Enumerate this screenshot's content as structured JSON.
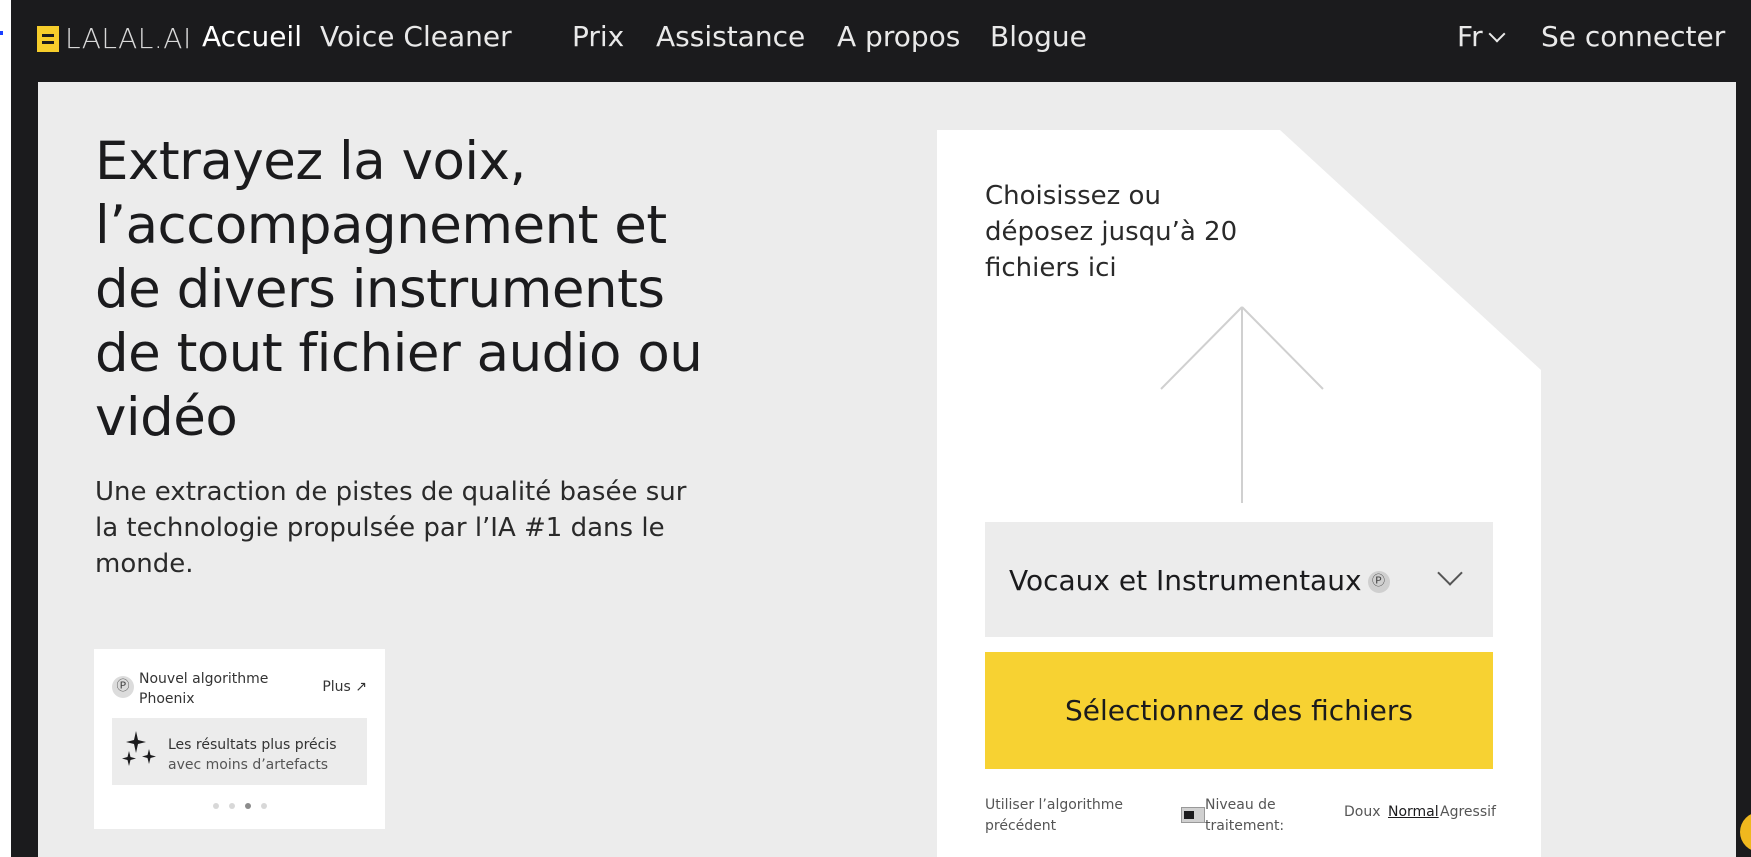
{
  "brand": {
    "name": "LALAL.AI",
    "accent": "#f7d232"
  },
  "nav": {
    "items": [
      {
        "label": "Accueil",
        "active": true
      },
      {
        "label": "Voice Cleaner"
      },
      {
        "label": "Prix"
      },
      {
        "label": "Assistance"
      },
      {
        "label": "A propos"
      },
      {
        "label": "Blogue"
      }
    ],
    "language": "Fr",
    "login": "Se connecter"
  },
  "hero": {
    "title": "Extrayez la voix, l’accompagnement et de divers instruments de tout fichier audio ou vidéo",
    "subtitle": "Une extraction de pistes de qualité basée sur la technologie propulsée par l’IA #1 dans le monde."
  },
  "promo": {
    "badge": "Ⓟ",
    "title": "Nouvel algorithme Phoenix",
    "more": "Plus ↗",
    "text_strong": "Les résultats plus précis",
    "text_muted": "avec moins d’artefacts",
    "dots_total": 4,
    "dots_active_index": 2
  },
  "upload": {
    "drop_text": "Choisissez ou déposez jusqu’à 20 fichiers ici",
    "separation_type": "Vocaux et Instrumentaux",
    "separation_badge": "Ⓟ",
    "select_button": "Sélectionnez des fichiers",
    "prev_algorithm": "Utiliser l’algorithme précédent",
    "level_label": "Niveau de traitement:",
    "levels": [
      "Doux",
      "Normal",
      "Agressif"
    ],
    "level_selected": "Normal"
  }
}
